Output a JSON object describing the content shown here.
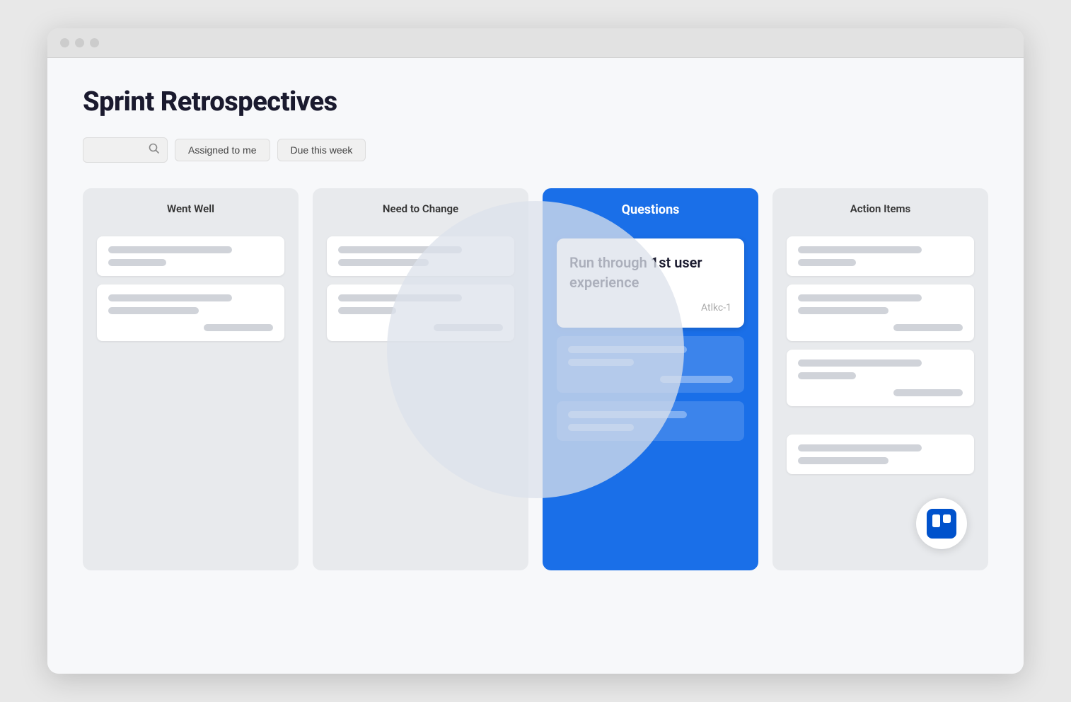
{
  "title": "Sprint Retrospectives",
  "filters": {
    "search_placeholder": "Search",
    "assigned_label": "Assigned to me",
    "due_label": "Due this week"
  },
  "columns": [
    {
      "id": "went-well",
      "header": "Went Well",
      "cards": [
        {
          "bars": [
            "long",
            "short"
          ]
        },
        {
          "bars": [
            "long",
            "medium"
          ]
        }
      ],
      "footer_bar": true
    },
    {
      "id": "need-to-change",
      "header": "Need to Change",
      "cards": [
        {
          "bars": [
            "long",
            "medium"
          ]
        },
        {
          "bars": [
            "long",
            "short"
          ]
        }
      ],
      "footer_bar": true
    },
    {
      "id": "questions",
      "header": "Questions",
      "featured_card": {
        "title": "Run through 1st user experience",
        "id": "Atlkc-1"
      },
      "cards": [
        {
          "bars": [
            "long",
            "short"
          ]
        },
        {
          "bars": [
            "long",
            "medium"
          ]
        }
      ],
      "footer_bar": true
    },
    {
      "id": "action-items",
      "header": "Action Items",
      "cards": [
        {
          "bars": [
            "long",
            "short"
          ]
        },
        {
          "bars": [
            "long",
            "medium"
          ]
        },
        {
          "bars": [
            "long",
            "short"
          ]
        }
      ],
      "footer_bar": true,
      "extra_card": true
    }
  ],
  "trello": {
    "logo_alt": "Trello"
  }
}
